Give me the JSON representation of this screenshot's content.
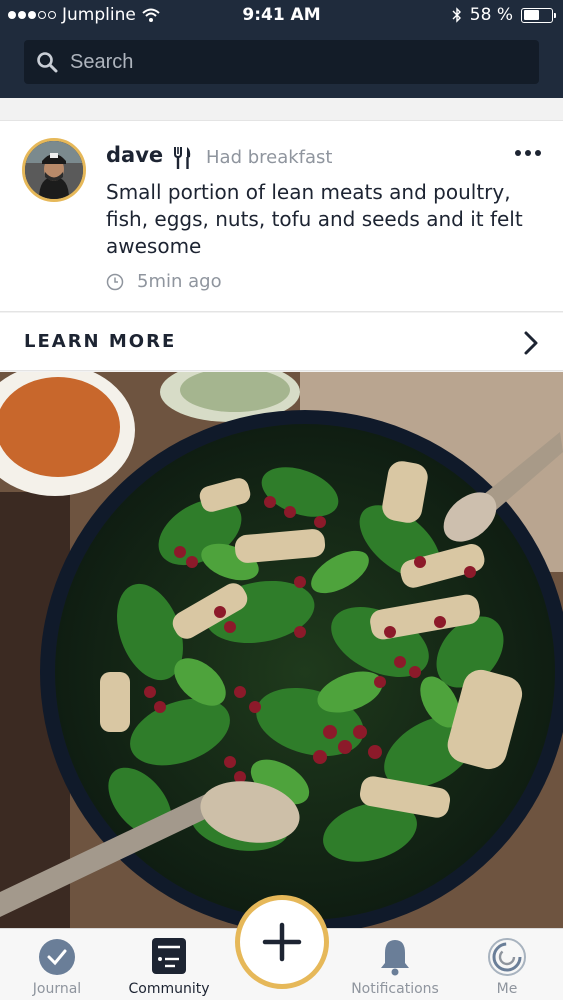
{
  "status_bar": {
    "carrier": "Jumpline",
    "time": "9:41 AM",
    "battery": "58 %",
    "battery_level": 0.58
  },
  "search": {
    "placeholder": "Search"
  },
  "post": {
    "username": "dave",
    "activity": "Had breakfast",
    "text": "Small portion of lean meats and poultry, fish, eggs, nuts, tofu and seeds and it felt awesome",
    "time_ago": "5min ago",
    "activity_icon": "fork-knife-icon"
  },
  "learn_more": {
    "label": "LEARN MORE"
  },
  "tabs": [
    {
      "label": "Journal",
      "icon": "check-circle-icon"
    },
    {
      "label": "Community",
      "icon": "feed-icon"
    },
    {
      "label": "Notifications",
      "icon": "bell-icon"
    },
    {
      "label": "Me",
      "icon": "profile-ring-icon"
    }
  ],
  "active_tab": "Community",
  "colors": {
    "header_bg": "#1f2b3c",
    "accent": "#e6b859",
    "text_dark": "#1d2432",
    "text_muted": "#8f959e"
  }
}
